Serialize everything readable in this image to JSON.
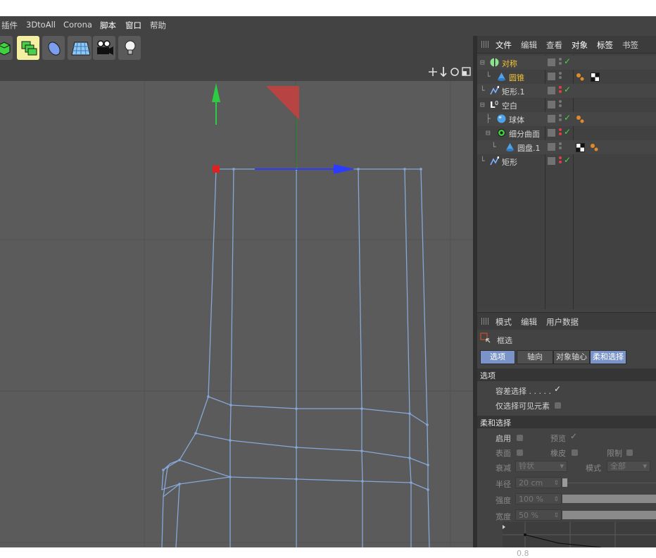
{
  "menu": {
    "items": [
      "插件",
      "3DtoAll",
      "Corona",
      "脚本",
      "窗口",
      "帮助"
    ]
  },
  "toolbar": {
    "icons": [
      "cube-primitive-icon",
      "nurbs-generator-icon",
      "deformer-icon",
      "floor-environment-icon",
      "camera-icon",
      "light-bulb-icon"
    ]
  },
  "viewport": {
    "nav_icons": [
      "move-view-icon",
      "zoom-view-icon",
      "rotate-view-icon",
      "maximize-view-icon"
    ]
  },
  "object_manager": {
    "tabs": [
      "文件",
      "编辑",
      "查看",
      "对象",
      "标签",
      "书签"
    ],
    "objects": [
      {
        "tree": "⊟",
        "name": "对称",
        "icon": "symmetry-icon",
        "selected": true,
        "check": "✓",
        "tags": []
      },
      {
        "tree": " └",
        "name": "圆锥",
        "icon": "cone-icon",
        "selected": true,
        "check": "",
        "tags": [
          "phong",
          "material"
        ]
      },
      {
        "tree": " └",
        "name": "矩形.1",
        "icon": "spline-icon",
        "selected": false,
        "check": "✓",
        "tags": []
      },
      {
        "tree": "⊟",
        "name": "空白",
        "icon": "null-icon",
        "selected": false,
        "check": "",
        "tags": []
      },
      {
        "tree": " ├",
        "name": "球体",
        "icon": "sphere-icon",
        "selected": false,
        "check": "✓",
        "tags": [
          "phong"
        ]
      },
      {
        "tree": " ⊟",
        "name": "细分曲面",
        "icon": "subdivision-icon",
        "selected": false,
        "check": "✓",
        "tags": []
      },
      {
        "tree": "   └",
        "name": "圆盘.1",
        "icon": "disc-icon",
        "selected": false,
        "check": "",
        "tags": [
          "material",
          "phong"
        ]
      },
      {
        "tree": " └",
        "name": "矩形",
        "icon": "spline-icon",
        "selected": false,
        "check": "✓",
        "tags": []
      }
    ]
  },
  "attributes": {
    "tabs": [
      "模式",
      "编辑",
      "用户数据"
    ],
    "tool_name": "框选",
    "subtabs": [
      "选项",
      "轴向",
      "对象轴心",
      "柔和选择"
    ],
    "options_section": "选项",
    "tolerance_label": "容差选择 . . . . .",
    "tolerance_check": "✓",
    "visible_only_label": "仅选择可见元素",
    "soft_section": "柔和选择",
    "enable_label": "启用",
    "preview_label": "预览",
    "preview_check": "✓",
    "surface_label": "表面",
    "rubber_label": "橡皮",
    "limit_label": "限制",
    "falloff_label": "衰减",
    "falloff_value": "铃状",
    "mode_label": "模式",
    "mode_value": "全部",
    "radius_label": "半径",
    "radius_value": "20 cm",
    "strength_label": "强度",
    "strength_value": "100 %",
    "width_label": "宽度",
    "width_value": "50 %",
    "graph_tick": "0.8"
  },
  "colors": {
    "selected_text": "#f0c23a",
    "active_tab": "#7a94c9",
    "mesh_wire": "#86a8d8",
    "axis_y": "#2ecc40",
    "axis_x": "#2a3cff",
    "selected_point": "#e02020"
  }
}
